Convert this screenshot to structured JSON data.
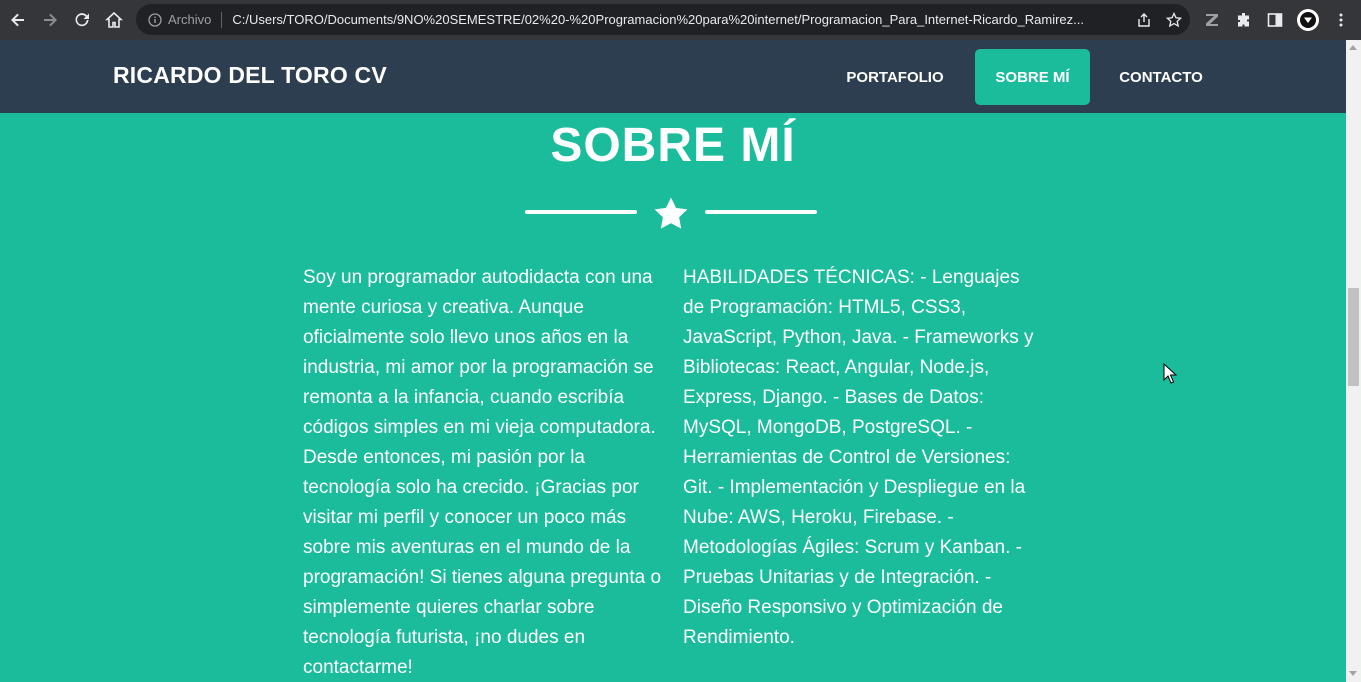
{
  "browser": {
    "security_label": "Archivo",
    "url": "C:/Users/TORO/Documents/9NO%20SEMESTRE/02%20-%20Programacion%20para%20internet/Programacion_Para_Internet-Ricardo_Ramirez..."
  },
  "navbar": {
    "brand": "RICARDO DEL TORO CV",
    "items": [
      {
        "label": "PORTAFOLIO"
      },
      {
        "label": "SOBRE MÍ"
      },
      {
        "label": "CONTACTO"
      }
    ]
  },
  "section": {
    "title": "SOBRE MÍ",
    "left_text": "Soy un programador autodidacta con una mente curiosa y creativa. Aunque oficialmente solo llevo unos años en la industria, mi amor por la programación se remonta a la infancia, cuando escribía códigos simples en mi vieja computadora. Desde entonces, mi pasión por la tecnología solo ha crecido. ¡Gracias por visitar mi perfil y conocer un poco más sobre mis aventuras en el mundo de la programación! Si tienes alguna pregunta o simplemente quieres charlar sobre tecnología futurista, ¡no dudes en contactarme!",
    "right_text": "HABILIDADES TÉCNICAS: - Lenguajes de Programación: HTML5, CSS3, JavaScript, Python, Java. - Frameworks y Bibliotecas: React, Angular, Node.js, Express, Django. - Bases de Datos: MySQL, MongoDB, PostgreSQL. - Herramientas de Control de Versiones: Git. - Implementación y Despliegue en la Nube: AWS, Heroku, Firebase. - Metodologías Ágiles: Scrum y Kanban. - Pruebas Unitarias y de Integración. - Diseño Responsivo y Optimización de Rendimiento."
  },
  "colors": {
    "primary": "#1abc9c",
    "navbar": "#2c3e50",
    "text": "#ffffff"
  },
  "icons": [
    "back-icon",
    "forward-icon",
    "reload-icon",
    "home-icon",
    "info-icon",
    "share-icon",
    "bookmark-star-icon",
    "zotero-icon",
    "extensions-icon",
    "sidebar-icon",
    "profile-icon",
    "menu-icon",
    "star-icon"
  ]
}
